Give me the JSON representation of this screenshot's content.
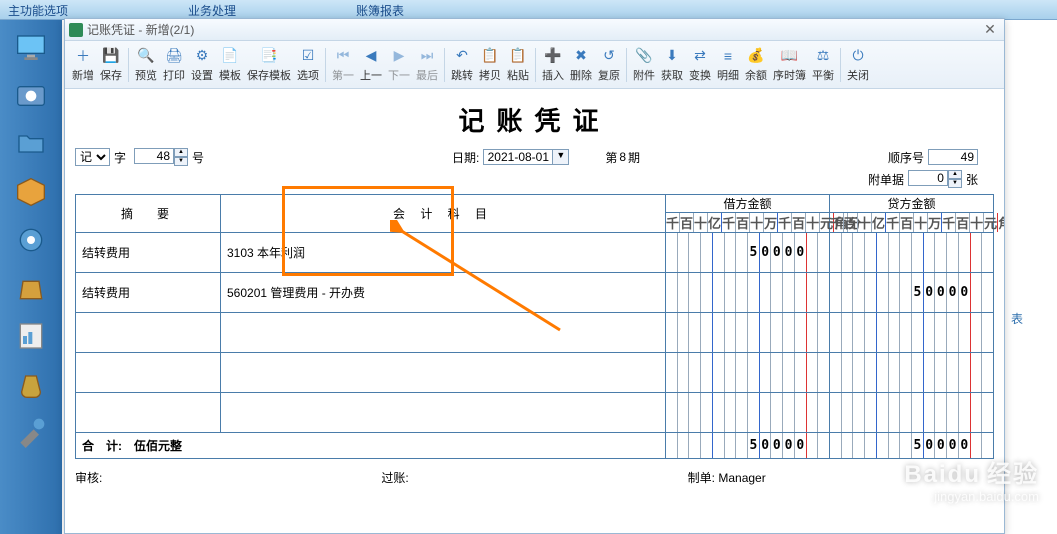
{
  "main_tabs": [
    "主功能选项",
    "业务处理",
    "账簿报表"
  ],
  "dialog": {
    "title": "记账凭证 - 新增(2/1)"
  },
  "toolbar": [
    {
      "k": "new",
      "l": "新增",
      "g": "＋"
    },
    {
      "k": "save",
      "l": "保存",
      "g": "💾"
    },
    {
      "sep": true
    },
    {
      "k": "preview",
      "l": "预览",
      "g": "🔍"
    },
    {
      "k": "print",
      "l": "打印",
      "g": "🖨"
    },
    {
      "k": "setup",
      "l": "设置",
      "g": "⚙"
    },
    {
      "k": "tpl",
      "l": "模板",
      "g": "📄"
    },
    {
      "k": "savetpl",
      "l": "保存模板",
      "g": "📑"
    },
    {
      "k": "option",
      "l": "选项",
      "g": "☑"
    },
    {
      "sep": true
    },
    {
      "k": "first",
      "l": "第一",
      "g": "⏮",
      "d": true
    },
    {
      "k": "prev",
      "l": "上一",
      "g": "◀"
    },
    {
      "k": "next",
      "l": "下一",
      "g": "▶",
      "d": true
    },
    {
      "k": "last",
      "l": "最后",
      "g": "⏭",
      "d": true
    },
    {
      "sep": true
    },
    {
      "k": "jump",
      "l": "跳转",
      "g": "↶"
    },
    {
      "k": "copy",
      "l": "拷贝",
      "g": "📋"
    },
    {
      "k": "paste",
      "l": "粘贴",
      "g": "📋"
    },
    {
      "sep": true
    },
    {
      "k": "insert",
      "l": "插入",
      "g": "➕"
    },
    {
      "k": "del",
      "l": "删除",
      "g": "✖"
    },
    {
      "k": "restore",
      "l": "复原",
      "g": "↺"
    },
    {
      "sep": true
    },
    {
      "k": "attach",
      "l": "附件",
      "g": "📎"
    },
    {
      "k": "fetch",
      "l": "获取",
      "g": "⬇"
    },
    {
      "k": "change",
      "l": "变换",
      "g": "⇄"
    },
    {
      "k": "detail",
      "l": "明细",
      "g": "≡"
    },
    {
      "k": "balance",
      "l": "余额",
      "g": "💰"
    },
    {
      "k": "seq",
      "l": "序时簿",
      "g": "📖"
    },
    {
      "k": "trial",
      "l": "平衡",
      "g": "⚖"
    },
    {
      "sep": true
    },
    {
      "k": "close",
      "l": "关闭",
      "g": "⏻"
    }
  ],
  "voucher": {
    "title": "记账凭证",
    "type": "记",
    "type_suffix": "字",
    "no": "48",
    "no_suffix": "号",
    "date_label": "日期:",
    "date": "2021-08-01",
    "period_prefix": "第",
    "period": "8",
    "period_suffix": "期",
    "seq_label": "顺序号",
    "seq": "49",
    "att_label": "附单据",
    "att": "0",
    "att_suffix": "张",
    "columns": {
      "summary": "摘　要",
      "account": "会 计 科 目",
      "debit": "借方金额",
      "credit": "贷方金额"
    },
    "digit_headers": [
      "千",
      "百",
      "十",
      "亿",
      "千",
      "百",
      "十",
      "万",
      "千",
      "百",
      "十",
      "元",
      "角",
      "分"
    ],
    "rows": [
      {
        "summary": "结转费用",
        "account": "3103 本年利润",
        "debit": "50000",
        "credit": ""
      },
      {
        "summary": "结转费用",
        "account": "560201 管理费用 - 开办费",
        "debit": "",
        "credit": "50000"
      },
      {
        "summary": "",
        "account": "",
        "debit": "",
        "credit": ""
      },
      {
        "summary": "",
        "account": "",
        "debit": "",
        "credit": ""
      },
      {
        "summary": "",
        "account": "",
        "debit": "",
        "credit": ""
      }
    ],
    "total": {
      "label": "合　计:",
      "text": "伍佰元整",
      "debit": "50000",
      "credit": "50000"
    },
    "footer": {
      "audit": "审核:",
      "post": "过账:",
      "maker_label": "制单:",
      "maker": "Manager"
    }
  },
  "watermark": {
    "brand": "Baidu",
    "cn": "经验",
    "url": "jingyan.baidu.com"
  },
  "right_strip": "表"
}
